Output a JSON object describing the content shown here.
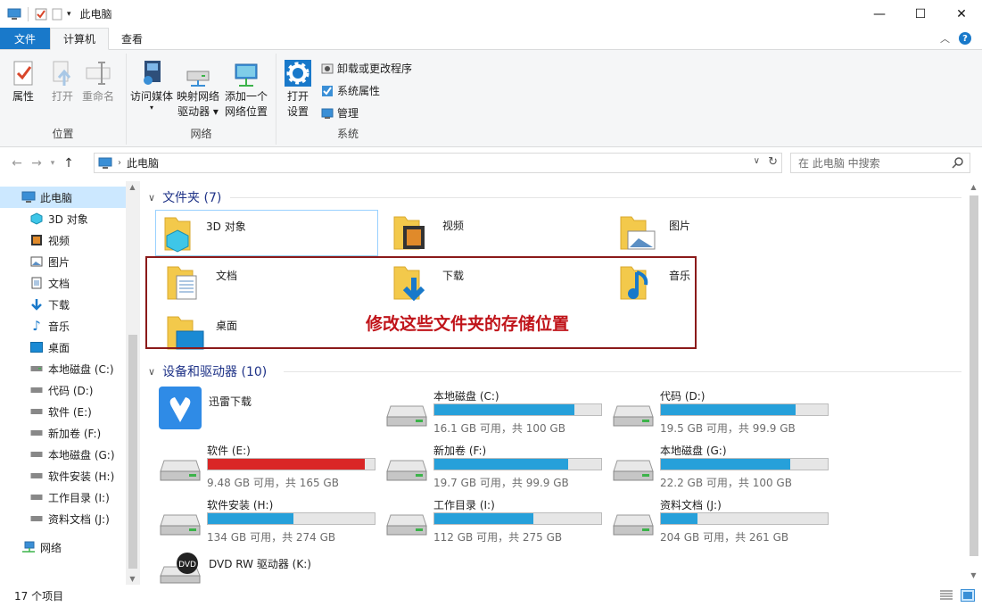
{
  "window": {
    "title": "此电脑"
  },
  "tabs": {
    "file": "文件",
    "computer": "计算机",
    "view": "查看"
  },
  "ribbon": {
    "location": {
      "title": "位置",
      "properties": "属性",
      "open": "打开",
      "rename": "重命名"
    },
    "network": {
      "title": "网络",
      "media_l1": "访问媒体",
      "map_l1": "映射网络",
      "map_l2": "驱动器",
      "add_l1": "添加一个",
      "add_l2": "网络位置"
    },
    "system": {
      "title": "系统",
      "settings_l1": "打开",
      "settings_l2": "设置",
      "uninstall": "卸载或更改程序",
      "sys_props": "系统属性",
      "manage": "管理"
    }
  },
  "address": {
    "crumb": "此电脑",
    "search_placeholder": "在 此电脑 中搜索"
  },
  "sidebar": {
    "items": [
      {
        "label": "此电脑",
        "icon": "computer-icon"
      },
      {
        "label": "3D 对象",
        "icon": "cube-icon"
      },
      {
        "label": "视频",
        "icon": "video-icon"
      },
      {
        "label": "图片",
        "icon": "picture-icon"
      },
      {
        "label": "文档",
        "icon": "document-icon"
      },
      {
        "label": "下载",
        "icon": "download-icon"
      },
      {
        "label": "音乐",
        "icon": "music-icon"
      },
      {
        "label": "桌面",
        "icon": "desktop-icon"
      },
      {
        "label": "本地磁盘 (C:)",
        "icon": "drive-icon"
      },
      {
        "label": "代码 (D:)",
        "icon": "drive-icon"
      },
      {
        "label": "软件 (E:)",
        "icon": "drive-icon"
      },
      {
        "label": "新加卷 (F:)",
        "icon": "drive-icon"
      },
      {
        "label": "本地磁盘 (G:)",
        "icon": "drive-icon"
      },
      {
        "label": "软件安装 (H:)",
        "icon": "drive-icon"
      },
      {
        "label": "工作目录 (I:)",
        "icon": "drive-icon"
      },
      {
        "label": "资料文档 (J:)",
        "icon": "drive-icon"
      },
      {
        "label": "网络",
        "icon": "network-icon"
      }
    ]
  },
  "folders": {
    "header": "文件夹 (7)",
    "items": [
      {
        "label": "3D 对象"
      },
      {
        "label": "视频"
      },
      {
        "label": "图片"
      },
      {
        "label": "文档"
      },
      {
        "label": "下载"
      },
      {
        "label": "音乐"
      },
      {
        "label": "桌面"
      }
    ]
  },
  "devices": {
    "header": "设备和驱动器 (10)",
    "app": {
      "label": "迅雷下载"
    },
    "drives": [
      {
        "name": "本地磁盘 (C:)",
        "info": "16.1 GB 可用，共 100 GB",
        "used_fraction": 0.839
      },
      {
        "name": "代码 (D:)",
        "info": "19.5 GB 可用，共 99.9 GB",
        "used_fraction": 0.805
      },
      {
        "name": "软件 (E:)",
        "info": "9.48 GB 可用，共 165 GB",
        "used_fraction": 0.943
      },
      {
        "name": "新加卷 (F:)",
        "info": "19.7 GB 可用，共 99.9 GB",
        "used_fraction": 0.803
      },
      {
        "name": "本地磁盘 (G:)",
        "info": "22.2 GB 可用，共 100 GB",
        "used_fraction": 0.778
      },
      {
        "name": "软件安装 (H:)",
        "info": "134 GB 可用，共 274 GB",
        "used_fraction": 0.511
      },
      {
        "name": "工作目录 (I:)",
        "info": "112 GB 可用，共 275 GB",
        "used_fraction": 0.593
      },
      {
        "name": "资料文档 (J:)",
        "info": "204 GB 可用，共 261 GB",
        "used_fraction": 0.218
      }
    ],
    "dvd": {
      "label": "DVD RW 驱动器 (K:)",
      "badge": "DVD"
    }
  },
  "annotation": {
    "text": "修改这些文件夹的存储位置"
  },
  "status": {
    "count": "17 个项目"
  }
}
